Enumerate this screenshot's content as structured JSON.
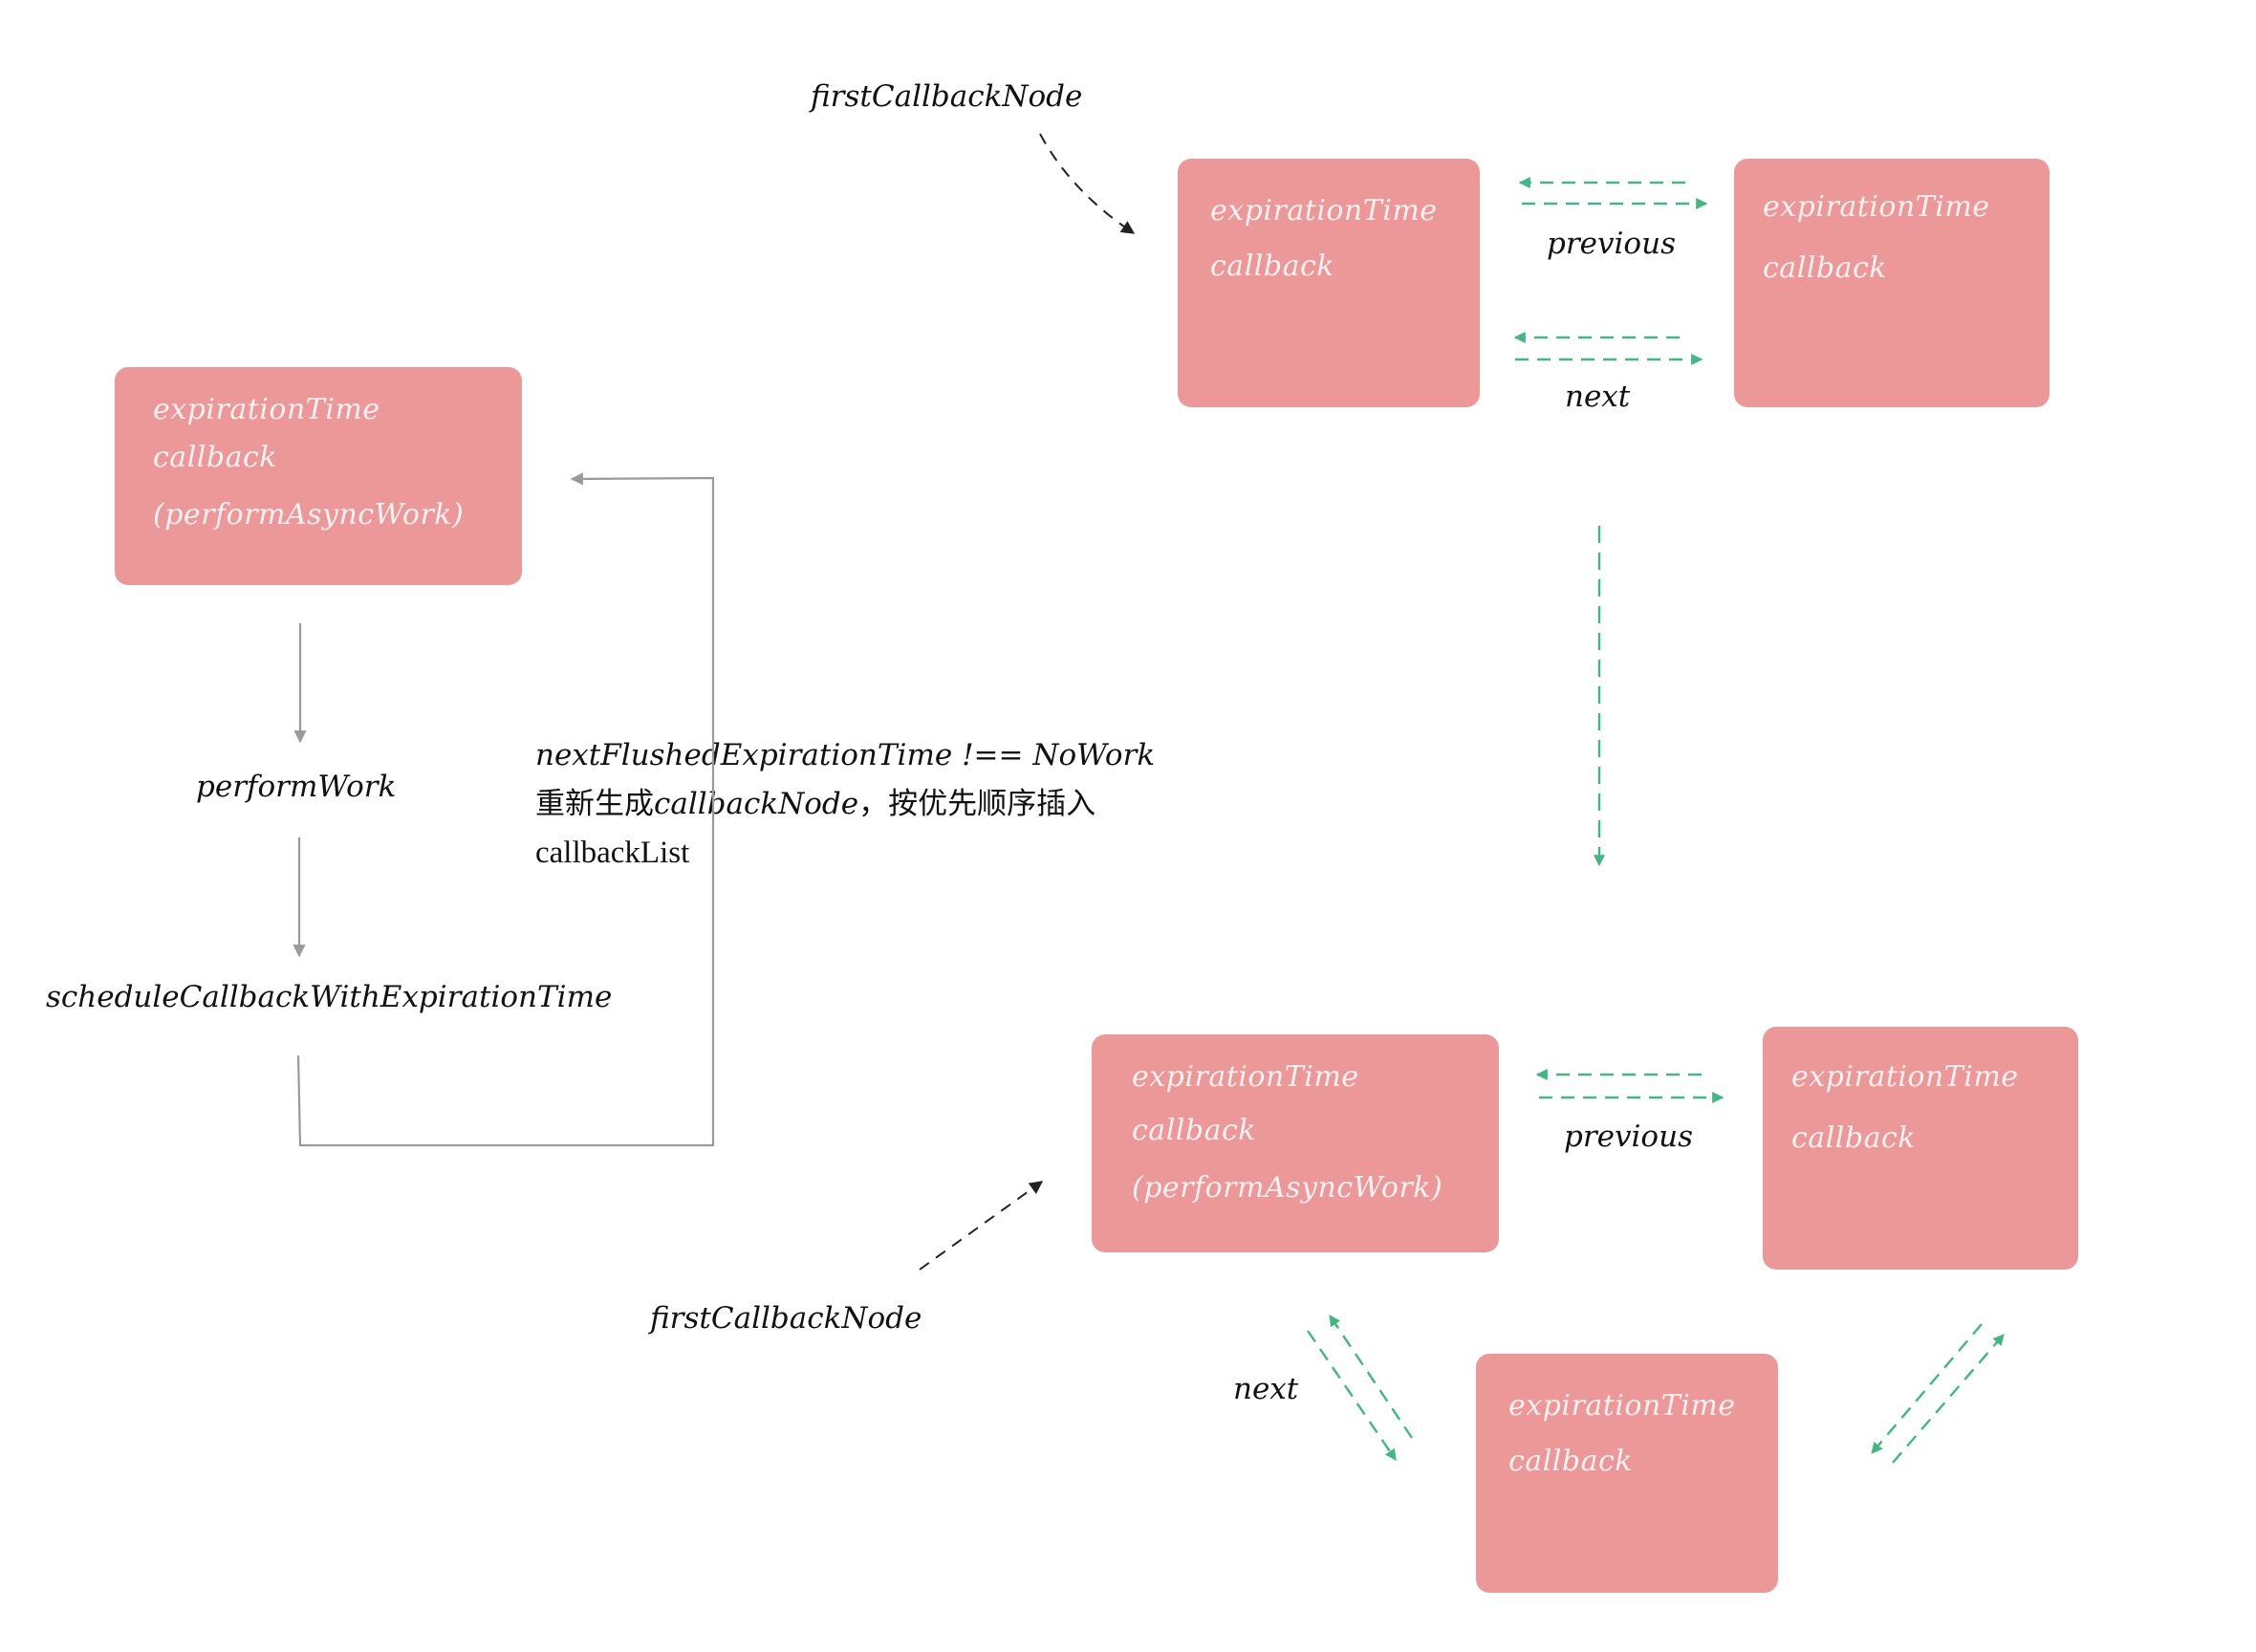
{
  "colors": {
    "node_fill": "#ec9898",
    "node_text": "#fdf3f2",
    "link_arrow": "#3fb882",
    "flow_arrow": "#9a9a9a",
    "pointer_arrow": "#222222",
    "label_text": "#111111"
  },
  "left_flow": {
    "node": {
      "lines": [
        "expirationTime",
        "callback",
        "(performAsyncWork)"
      ]
    },
    "step_perform": "performWork",
    "step_schedule": "scheduleCallbackWithExpirationTime",
    "loop_note": {
      "line1": "nextFlushedExpirationTime !== NoWork",
      "line2_cjk_a": "重新生成",
      "line2_mid": "callbackNode",
      "line2_cjk_b": "，按优先顺序插入",
      "line3": "callbackList"
    }
  },
  "top_list": {
    "pointer_label": "firstCallbackNode",
    "nodes": [
      {
        "lines": [
          "expirationTime",
          "callback"
        ]
      },
      {
        "lines": [
          "expirationTime",
          "callback"
        ]
      }
    ],
    "link_labels": {
      "previous": "previous",
      "next": "next"
    }
  },
  "bottom_list": {
    "pointer_label": "firstCallbackNode",
    "nodes": [
      {
        "lines": [
          "expirationTime",
          "callback",
          "(performAsyncWork)"
        ]
      },
      {
        "lines": [
          "expirationTime",
          "callback"
        ]
      },
      {
        "lines": [
          "expirationTime",
          "callback"
        ]
      }
    ],
    "link_labels": {
      "previous": "previous",
      "next": "next"
    }
  }
}
